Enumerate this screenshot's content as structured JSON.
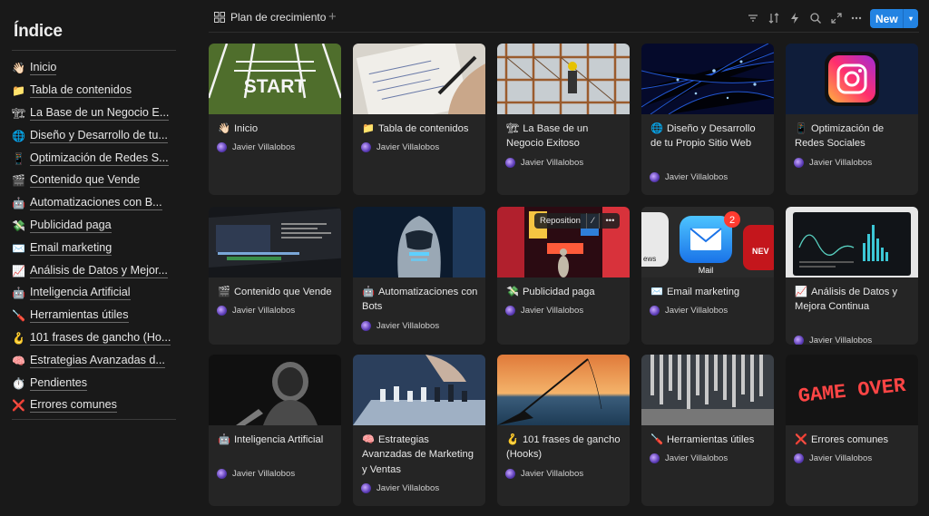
{
  "index": {
    "title": "Índice",
    "items": [
      {
        "emoji": "👋🏻",
        "label": "Inicio"
      },
      {
        "emoji": "📁",
        "label": "Tabla de contenidos"
      },
      {
        "emoji": "🏗",
        "label": "La Base de un Negocio E..."
      },
      {
        "emoji": "🌐",
        "label": "Diseño y Desarrollo de tu..."
      },
      {
        "emoji": "📱",
        "label": "Optimización de Redes S..."
      },
      {
        "emoji": "🎬",
        "label": "Contenido que Vende"
      },
      {
        "emoji": "🤖",
        "label": "Automatizaciones con B..."
      },
      {
        "emoji": "💸",
        "label": "Publicidad paga"
      },
      {
        "emoji": "✉️",
        "label": "Email marketing"
      },
      {
        "emoji": "📈",
        "label": "Análisis de Datos y Mejor..."
      },
      {
        "emoji": "🤖",
        "label": "Inteligencia Artificial"
      },
      {
        "emoji": "🪛",
        "label": "Herramientas útiles"
      },
      {
        "emoji": "🪝",
        "label": "101 frases de gancho (Ho..."
      },
      {
        "emoji": "🧠",
        "label": "Estrategias Avanzadas d..."
      },
      {
        "emoji": "⏱️",
        "label": "Pendientes"
      },
      {
        "emoji": "❌",
        "label": "Errores comunes"
      }
    ]
  },
  "toolbar": {
    "view_name": "Plan de crecimiento",
    "add_view": "+",
    "filter_icon": "filter-icon",
    "sort_icon": "sort-icon",
    "automation_icon": "lightning-icon",
    "search_icon": "search-icon",
    "expand_icon": "expand-icon",
    "more_icon": "more-icon",
    "new_label": "New",
    "new_chevron": "▾"
  },
  "reposition": {
    "label": "Reposition",
    "edit": "⁄",
    "more": "•••"
  },
  "cards": [
    {
      "emoji": "👋🏻",
      "title": "Inicio",
      "author": "Javier Villalobos",
      "cover": "start"
    },
    {
      "emoji": "📁",
      "title": "Tabla de contenidos",
      "author": "Javier Villalobos",
      "cover": "notebook"
    },
    {
      "emoji": "🏗",
      "title": "La Base de un Negocio Exitoso",
      "author": "Javier Villalobos",
      "cover": "scaffold"
    },
    {
      "emoji": "🌐",
      "title": "Diseño y Desarrollo de tu Propio Sitio Web",
      "author": "Javier Villalobos",
      "cover": "fiber"
    },
    {
      "emoji": "📱",
      "title": "Optimización de Redes Sociales",
      "author": "Javier Villalobos",
      "cover": "instagram"
    },
    {
      "emoji": "🎬",
      "title": "Contenido que Vende",
      "author": "Javier Villalobos",
      "cover": "editor"
    },
    {
      "emoji": "🤖",
      "title": "Automatizaciones con Bots",
      "author": "Javier Villalobos",
      "cover": "robot"
    },
    {
      "emoji": "💸",
      "title": "Publicidad paga",
      "author": "Javier Villalobos",
      "cover": "timessquare"
    },
    {
      "emoji": "✉️",
      "title": "Email marketing",
      "author": "Javier Villalobos",
      "cover": "mail",
      "cover_badge": "2",
      "cover_caption": "Mail",
      "cover_left_text": "ews",
      "cover_right_text": "NEV"
    },
    {
      "emoji": "📈",
      "title": "Análisis de Datos y Mejora Continua",
      "author": "Javier Villalobos",
      "cover": "dashboard"
    },
    {
      "emoji": "🤖",
      "title": "Inteligencia Artificial",
      "author": "Javier Villalobos",
      "cover": "android"
    },
    {
      "emoji": "🧠",
      "title": "Estrategias Avanzadas de Marketing y Ventas",
      "author": "Javier Villalobos",
      "cover": "chess"
    },
    {
      "emoji": "🪝",
      "title": "101 frases de gancho (Hooks)",
      "author": "Javier Villalobos",
      "cover": "fishing"
    },
    {
      "emoji": "🪛",
      "title": "Herramientas útiles",
      "author": "Javier Villalobos",
      "cover": "tools"
    },
    {
      "emoji": "❌",
      "title": "Errores comunes",
      "author": "Javier Villalobos",
      "cover": "gameover",
      "cover_text": "GAME OVER"
    }
  ]
}
